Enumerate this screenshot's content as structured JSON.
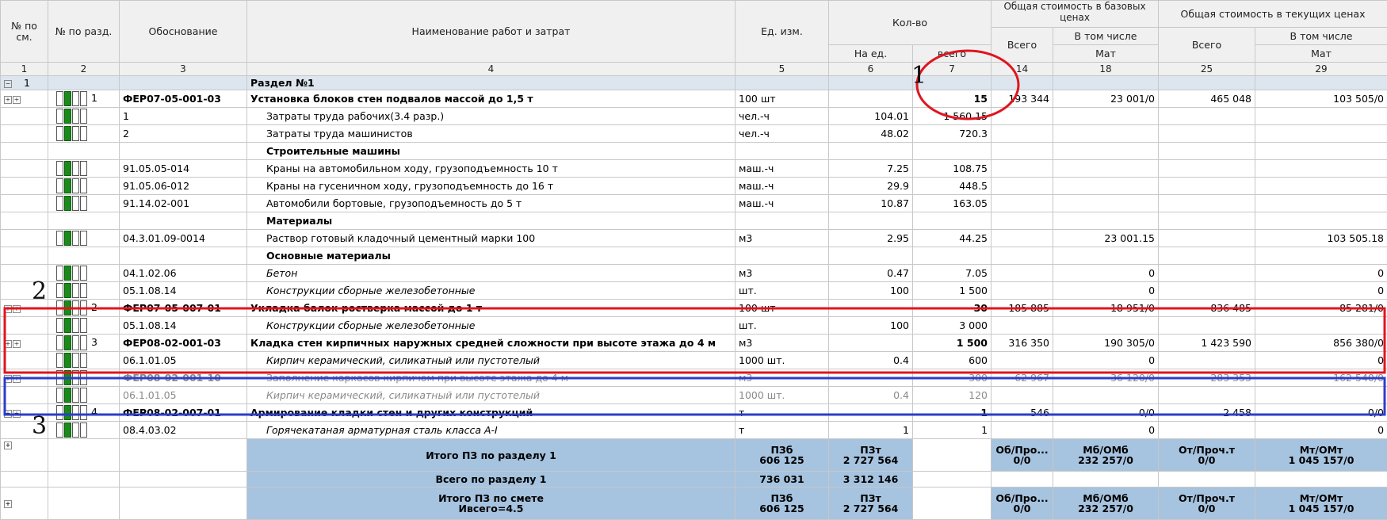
{
  "headers": {
    "c1": "№ по см.",
    "c2": "№ по разд.",
    "c3": "Обоснование",
    "c4": "Наименование работ и затрат",
    "c5": "Ед. изм.",
    "qty": "Кол-во",
    "qty_unit": "На ед.",
    "qty_total": "всего",
    "base": "Общая стоимость в базовых ценах",
    "base_total": "Всего",
    "base_incl": "В том числе",
    "base_mat": "Мат",
    "cur": "Общая стоимость в текущих ценах",
    "cur_total": "Всего",
    "cur_incl": "В том числе",
    "cur_mat": "Мат",
    "nums": [
      "1",
      "2",
      "3",
      "4",
      "5",
      "6",
      "7",
      "14",
      "18",
      "25",
      "29"
    ]
  },
  "section": {
    "num": "1",
    "title": "Раздел №1"
  },
  "rows": [
    {
      "n2": "1",
      "code": "ФЕР07-05-001-03",
      "name": "Установка блоков стен подвалов массой до 1,5 т",
      "unit": "100 шт",
      "per": "",
      "total": "15",
      "b_all": "193 344",
      "b_mat": "23 001/0",
      "c_all": "465 048",
      "c_mat": "103 505/0"
    },
    {
      "n2": "",
      "code": "1",
      "name": "Затраты труда рабочих(3.4 разр.)",
      "unit": "чел.-ч",
      "per": "104.01",
      "total": "1 560.15",
      "b_all": "",
      "b_mat": "",
      "c_all": "",
      "c_mat": ""
    },
    {
      "n2": "",
      "code": "2",
      "name": "Затраты труда машинистов",
      "unit": "чел.-ч",
      "per": "48.02",
      "total": "720.3",
      "b_all": "",
      "b_mat": "",
      "c_all": "",
      "c_mat": ""
    },
    {
      "n2": "",
      "code": "",
      "name": "Строительные машины",
      "unit": "",
      "per": "",
      "total": "",
      "b_all": "",
      "b_mat": "",
      "c_all": "",
      "c_mat": ""
    },
    {
      "n2": "",
      "code": "91.05.05-014",
      "name": "Краны на автомобильном ходу, грузоподъемность 10 т",
      "unit": "маш.-ч",
      "per": "7.25",
      "total": "108.75",
      "b_all": "",
      "b_mat": "",
      "c_all": "",
      "c_mat": ""
    },
    {
      "n2": "",
      "code": "91.05.06-012",
      "name": "Краны на гусеничном ходу, грузоподъемность до 16 т",
      "unit": "маш.-ч",
      "per": "29.9",
      "total": "448.5",
      "b_all": "",
      "b_mat": "",
      "c_all": "",
      "c_mat": ""
    },
    {
      "n2": "",
      "code": "91.14.02-001",
      "name": "Автомобили бортовые, грузоподъемность до 5 т",
      "unit": "маш.-ч",
      "per": "10.87",
      "total": "163.05",
      "b_all": "",
      "b_mat": "",
      "c_all": "",
      "c_mat": ""
    },
    {
      "n2": "",
      "code": "",
      "name": "Материалы",
      "unit": "",
      "per": "",
      "total": "",
      "b_all": "",
      "b_mat": "",
      "c_all": "",
      "c_mat": ""
    },
    {
      "n2": "",
      "code": "04.3.01.09-0014",
      "name": "Раствор готовый кладочный цементный марки 100",
      "unit": "м3",
      "per": "2.95",
      "total": "44.25",
      "b_all": "",
      "b_mat": "23 001.15",
      "c_all": "",
      "c_mat": "103 505.18"
    },
    {
      "n2": "",
      "code": "",
      "name": "Основные материалы",
      "unit": "",
      "per": "",
      "total": "",
      "b_all": "",
      "b_mat": "",
      "c_all": "",
      "c_mat": ""
    },
    {
      "n2": "",
      "code": "04.1.02.06",
      "name": "Бетон",
      "unit": "м3",
      "per": "0.47",
      "total": "7.05",
      "b_all": "",
      "b_mat": "0",
      "c_all": "",
      "c_mat": "0"
    },
    {
      "n2": "",
      "code": "05.1.08.14",
      "name": "Конструкции сборные железобетонные",
      "unit": "шт.",
      "per": "100",
      "total": "1 500",
      "b_all": "",
      "b_mat": "0",
      "c_all": "",
      "c_mat": "0"
    },
    {
      "n2": "2",
      "code": "ФЕР07-05-007-01",
      "name": "Укладка балок ростверка массой до 1 т",
      "unit": "100 шт",
      "per": "",
      "total": "30",
      "b_all": "185 885",
      "b_mat": "18 951/0",
      "c_all": "836 485",
      "c_mat": "85 281/0"
    },
    {
      "n2": "",
      "code": "05.1.08.14",
      "name": "Конструкции сборные железобетонные",
      "unit": "шт.",
      "per": "100",
      "total": "3 000",
      "b_all": "",
      "b_mat": "",
      "c_all": "",
      "c_mat": ""
    },
    {
      "n2": "3",
      "code": "ФЕР08-02-001-03",
      "name": "Кладка стен кирпичных наружных средней сложности при высоте этажа до 4 м",
      "unit": "м3",
      "per": "",
      "total": "1 500",
      "b_all": "316 350",
      "b_mat": "190 305/0",
      "c_all": "1 423 590",
      "c_mat": "856 380/0"
    },
    {
      "n2": "",
      "code": "06.1.01.05",
      "name": "Кирпич керамический, силикатный или пустотелый",
      "unit": "1000 шт.",
      "per": "0.4",
      "total": "600",
      "b_all": "",
      "b_mat": "0",
      "c_all": "",
      "c_mat": "0"
    },
    {
      "n2": "",
      "code": "ФЕР08-02-001-10",
      "name": "Заполнение каркасов кирпичом при высоте этажа до 4 м",
      "unit": "м3",
      "per": "",
      "total": "300",
      "b_all": "62 967",
      "b_mat": "36 120/0",
      "c_all": "283 353",
      "c_mat": "162 540/0"
    },
    {
      "n2": "",
      "code": "06.1.01.05",
      "name": "Кирпич керамический, силикатный или пустотелый",
      "unit": "1000 шт.",
      "per": "0.4",
      "total": "120",
      "b_all": "",
      "b_mat": "",
      "c_all": "",
      "c_mat": ""
    },
    {
      "n2": "4",
      "code": "ФЕР08-02-007-01",
      "name": "Армирование кладки стен и других конструкций",
      "unit": "т",
      "per": "",
      "total": "1",
      "b_all": "546",
      "b_mat": "0/0",
      "c_all": "2 458",
      "c_mat": "0/0"
    },
    {
      "n2": "",
      "code": "08.4.03.02",
      "name": "Горячекатаная арматурная сталь класса А-I",
      "unit": "т",
      "per": "1",
      "total": "1",
      "b_all": "",
      "b_mat": "0",
      "c_all": "",
      "c_mat": "0"
    }
  ],
  "totals": {
    "sec_label": "Итого ПЗ по разделу 1",
    "pzb": "ПЗб",
    "pzb_v": "606 125",
    "pzt": "ПЗт",
    "pzt_v": "2 727 564",
    "ob": "Об/Про...",
    "ob_v": "0/0",
    "mb": "Мб/ОМб",
    "mb_v": "232 257/0",
    "ot": "От/Проч.т",
    "ot_v": "0/0",
    "mt": "Мт/ОМт",
    "mt_v": "1 045 157/0",
    "all_label": "Всего по разделу 1",
    "all_b": "736 031",
    "all_t": "3 312 146",
    "est_label": "Итого ПЗ по смете",
    "est_sub": "Ивсего=4.5",
    "est_pzb_v": "606 125",
    "est_pzt_v": "2 727 564",
    "est_ob_v": "0/0",
    "est_mb_v": "232 257/0",
    "est_ot_v": "0/0",
    "est_mt_v": "1 045 157/0"
  },
  "annotations": {
    "n1": "1",
    "n2": "2",
    "n3": "3"
  },
  "colors": {
    "red": "#e0141e",
    "blue": "#2b3ec8",
    "green": "#1a8a1a",
    "total_bg": "#a6c3df"
  }
}
